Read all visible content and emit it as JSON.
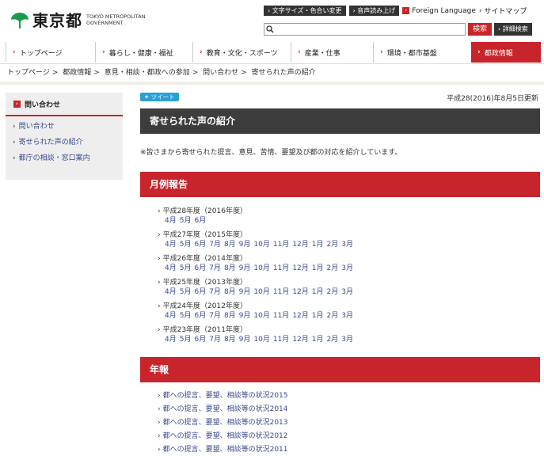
{
  "header": {
    "logo_title": "東京都",
    "logo_sub_line1": "TOKYO METROPOLITAN",
    "logo_sub_line2": "GOVERNMENT",
    "utility": {
      "text_size_btn": "文字サイズ・色合い変更",
      "read_aloud_btn": "音声読み上げ",
      "foreign_language": "Foreign Language",
      "sitemap": "サイトマップ"
    },
    "search": {
      "placeholder": "",
      "button": "検索",
      "advanced_button": "詳細検索"
    }
  },
  "gnav": {
    "items": [
      {
        "label": "トップページ"
      },
      {
        "label": "暮らし・健康・福祉"
      },
      {
        "label": "教育・文化・スポーツ"
      },
      {
        "label": "産業・仕事"
      },
      {
        "label": "環境・都市基盤"
      },
      {
        "label": "都政情報"
      }
    ]
  },
  "breadcrumb": [
    "トップページ",
    "都政情報",
    "意見・相談・都政への参加",
    "問い合わせ",
    "寄せられた声の紹介"
  ],
  "breadcrumb_sep": ">",
  "sidebar": {
    "heading": "問い合わせ",
    "items": [
      {
        "label": "問い合わせ"
      },
      {
        "label": "寄せられた声の紹介"
      },
      {
        "label": "都庁の相談・窓口案内"
      }
    ]
  },
  "main": {
    "tweet_button": "ツイート",
    "updated": "平成28(2016)年8月5日更新",
    "title": "寄せられた声の紹介",
    "intro": "※皆さまから寄せられた提言、意見、苦情、要望及び都の対応を紹介しています。",
    "monthly_heading": "月例報告",
    "years": [
      {
        "label": "平成28年度（2016年度）",
        "months": [
          "4月",
          "5月",
          "6月"
        ]
      },
      {
        "label": "平成27年度（2015年度）",
        "months": [
          "4月",
          "5月",
          "6月",
          "7月",
          "8月",
          "9月",
          "10月",
          "11月",
          "12月",
          "1月",
          "2月",
          "3月"
        ]
      },
      {
        "label": "平成26年度（2014年度）",
        "months": [
          "4月",
          "5月",
          "6月",
          "7月",
          "8月",
          "9月",
          "10月",
          "11月",
          "12月",
          "1月",
          "2月",
          "3月"
        ]
      },
      {
        "label": "平成25年度（2013年度）",
        "months": [
          "4月",
          "5月",
          "6月",
          "7月",
          "8月",
          "9月",
          "10月",
          "11月",
          "12月",
          "1月",
          "2月",
          "3月"
        ]
      },
      {
        "label": "平成24年度（2012年度）",
        "months": [
          "4月",
          "5月",
          "6月",
          "7月",
          "8月",
          "9月",
          "10月",
          "11月",
          "12月",
          "1月",
          "2月",
          "3月"
        ]
      },
      {
        "label": "平成23年度（2011年度）",
        "months": [
          "4月",
          "5月",
          "6月",
          "7月",
          "8月",
          "9月",
          "10月",
          "11月",
          "12月",
          "1月",
          "2月",
          "3月"
        ]
      }
    ],
    "annual_heading": "年報",
    "annual_items": [
      {
        "label": "都への提言、要望、相談等の状況2015"
      },
      {
        "label": "都への提言、要望、相談等の状況2014"
      },
      {
        "label": "都への提言、要望、相談等の状況2013"
      },
      {
        "label": "都への提言、要望、相談等の状況2012"
      },
      {
        "label": "都への提言、要望、相談等の状況2011"
      }
    ]
  },
  "colors": {
    "accent": "#c8242b",
    "dark": "#3d3d3d",
    "link": "#3a4a8c",
    "logo_green": "#1a9b4b",
    "tweet": "#2a9fd6"
  }
}
